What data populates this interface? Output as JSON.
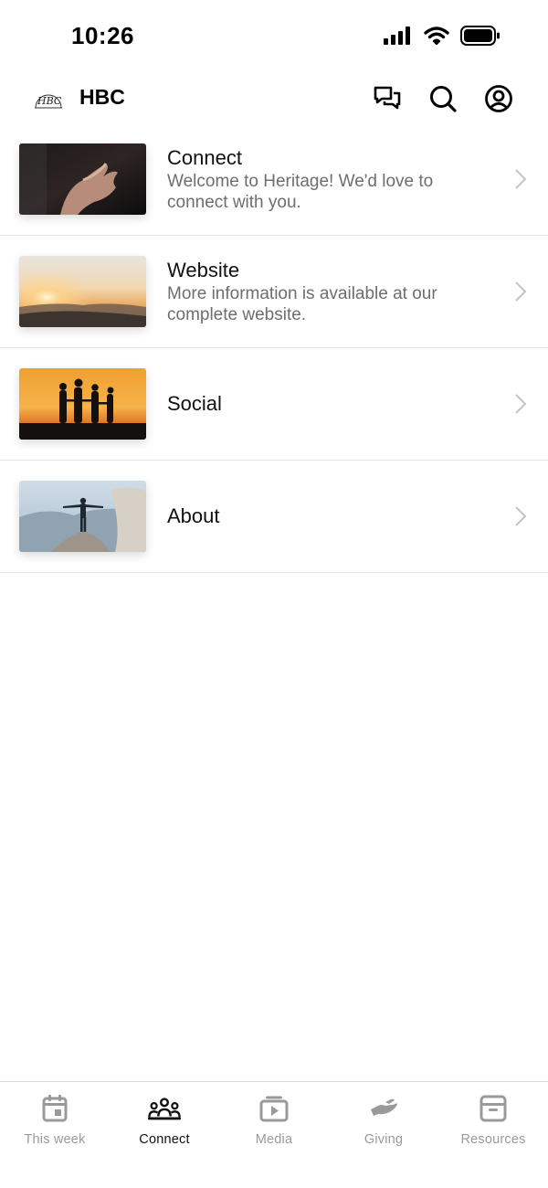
{
  "status_bar": {
    "time": "10:26"
  },
  "header": {
    "logo_text": "HBC",
    "title": "HBC",
    "icons": [
      "chat-bubbles-icon",
      "search-icon",
      "account-icon"
    ]
  },
  "list": [
    {
      "title": "Connect",
      "description": "Welcome to Heritage! We'd love to connect with you.",
      "image": "open-hand-photo"
    },
    {
      "title": "Website",
      "description": "More information is available at our complete website.",
      "image": "sunset-mountains-photo"
    },
    {
      "title": "Social",
      "description": "",
      "image": "silhouettes-sunset-photo"
    },
    {
      "title": "About",
      "description": "",
      "image": "person-on-mountain-photo"
    }
  ],
  "tabs": [
    {
      "label": "This week",
      "icon": "calendar-icon",
      "active": false
    },
    {
      "label": "Connect",
      "icon": "people-icon",
      "active": true
    },
    {
      "label": "Media",
      "icon": "play-icon",
      "active": false
    },
    {
      "label": "Giving",
      "icon": "hand-icon",
      "active": false
    },
    {
      "label": "Resources",
      "icon": "archive-box-icon",
      "active": false
    }
  ],
  "colors": {
    "text_primary": "#111111",
    "text_secondary": "#6d6d72",
    "tab_inactive": "#9a9a9a",
    "divider": "#e6e6e6"
  }
}
